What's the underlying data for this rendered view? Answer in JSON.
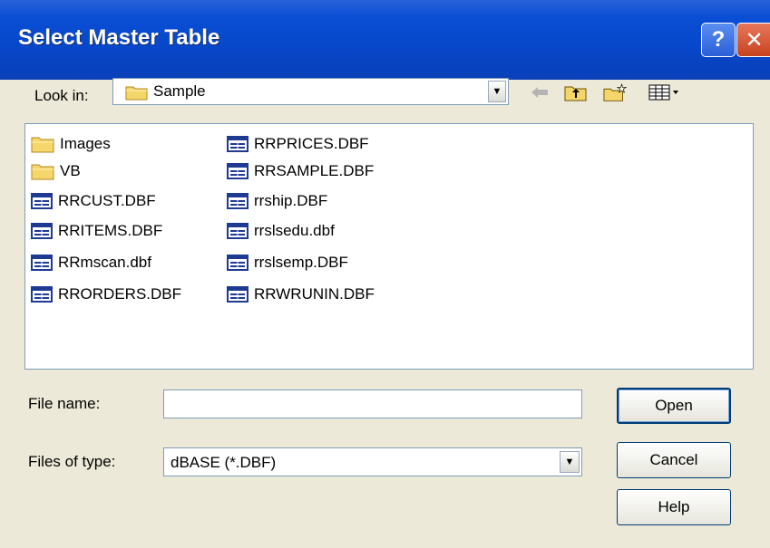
{
  "window": {
    "title": "Select Master Table",
    "help_glyph": "?",
    "close_glyph": "✕"
  },
  "lookin": {
    "label": "Look in:",
    "value": "Sample"
  },
  "toolbar": {
    "icons": [
      "back-arrow-icon",
      "up-folder-icon",
      "new-folder-icon",
      "view-menu-icon"
    ]
  },
  "files": {
    "col1": [
      {
        "name": "Images",
        "type": "folder"
      },
      {
        "name": "VB",
        "type": "folder"
      },
      {
        "name": "RRCUST.DBF",
        "type": "table"
      },
      {
        "name": "RRITEMS.DBF",
        "type": "table"
      },
      {
        "name": "RRmscan.dbf",
        "type": "table"
      },
      {
        "name": "RRORDERS.DBF",
        "type": "table"
      }
    ],
    "col2": [
      {
        "name": "RRPRICES.DBF",
        "type": "table"
      },
      {
        "name": "RRSAMPLE.DBF",
        "type": "table"
      },
      {
        "name": "rrship.DBF",
        "type": "table"
      },
      {
        "name": "rrslsedu.dbf",
        "type": "table"
      },
      {
        "name": "rrslsemp.DBF",
        "type": "table"
      },
      {
        "name": "RRWRUNIN.DBF",
        "type": "table"
      }
    ]
  },
  "form": {
    "filename_label": "File name:",
    "filename_value": "",
    "filetype_label": "Files of type:",
    "filetype_value": "dBASE (*.DBF)"
  },
  "buttons": {
    "open": "Open",
    "cancel": "Cancel",
    "help": "Help"
  },
  "colors": {
    "titlebar": "#0a4fd6",
    "dialog_bg": "#ece9d8",
    "folder_yellow": "#f5d66b",
    "table_blue": "#1f3a93"
  }
}
